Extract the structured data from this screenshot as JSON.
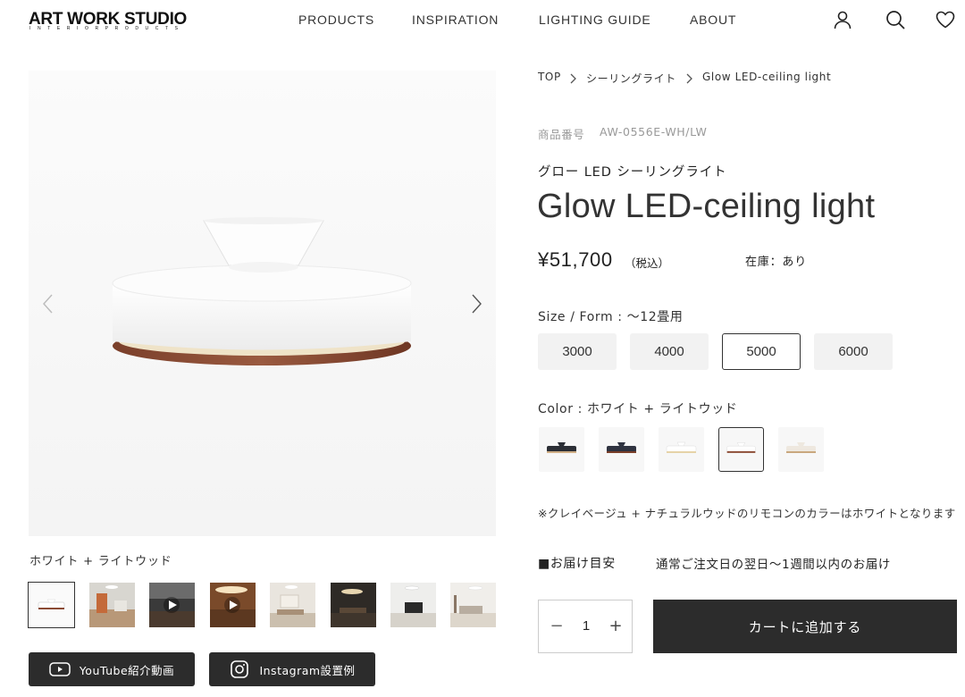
{
  "header": {
    "logo_main": "ART WORK STUDIO",
    "logo_sub": "INTERIORPRODUCTS",
    "nav": [
      "PRODUCTS",
      "INSPIRATION",
      "LIGHTING GUIDE",
      "ABOUT"
    ],
    "icons": [
      "user-icon",
      "search-icon",
      "heart-icon"
    ]
  },
  "gallery": {
    "caption": "ホワイト + ライトウッド",
    "thumbnails": 8,
    "selected_thumbnail": 1,
    "video_thumbnails": [
      3,
      4
    ]
  },
  "social": {
    "youtube_label": "YouTube紹介動画",
    "instagram_label": "Instagram設置例"
  },
  "breadcrumb": [
    "TOP",
    "シーリングライト",
    "Glow LED-ceiling light"
  ],
  "product": {
    "sku_label": "商品番号",
    "sku": "AW-0556E-WH/LW",
    "name_ja": "グロー LED シーリングライト",
    "name_en": "Glow LED-ceiling light",
    "price": "¥51,700",
    "tax_note": "（税込）",
    "stock": "在庫：あり"
  },
  "options": {
    "size_label": "Size / Form : 〜12畳用",
    "sizes": [
      "3000",
      "4000",
      "5000",
      "6000"
    ],
    "selected_size": "5000",
    "color_label": "Color : ホワイト + ライトウッド",
    "color_swatches": 5,
    "selected_color_index": 4,
    "note": "※クレイベージュ + ナチュラルウッドのリモコンのカラーはホワイトとなります"
  },
  "delivery": {
    "label": "■お届け目安",
    "value": "通常ご注文日の翌日〜1週間以内のお届け"
  },
  "cart": {
    "quantity": "1",
    "minus": "−",
    "plus": "+",
    "add_label": "カートに追加する"
  },
  "colors": {
    "button_dark": "#2c2c2c",
    "size_bg": "#f2f2f2",
    "muted_text": "#999999"
  }
}
